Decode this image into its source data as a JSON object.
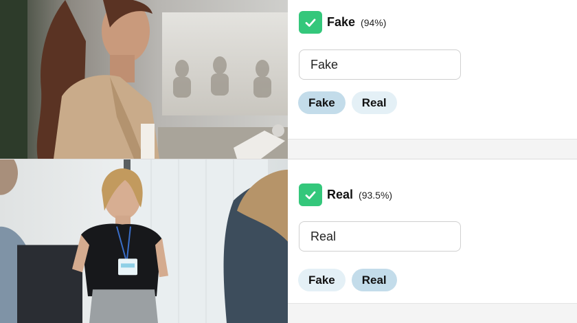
{
  "items": [
    {
      "prediction": {
        "label": "Fake",
        "confidence": "(94%)"
      },
      "answer_value": "Fake",
      "options": [
        {
          "label": "Fake",
          "selected": true
        },
        {
          "label": "Real",
          "selected": false
        }
      ],
      "image_subject": "woman in beige blazer at conference"
    },
    {
      "prediction": {
        "label": "Real",
        "confidence": "(93.5%)"
      },
      "answer_value": "Real",
      "options": [
        {
          "label": "Fake",
          "selected": false
        },
        {
          "label": "Real",
          "selected": true
        }
      ],
      "image_subject": "smiling presenter with lanyard"
    }
  ],
  "colors": {
    "check_green": "#34c77b",
    "chip_active": "#c3dcea",
    "chip_inactive": "#e4f0f6"
  },
  "icons": [
    "checkmark-icon"
  ]
}
